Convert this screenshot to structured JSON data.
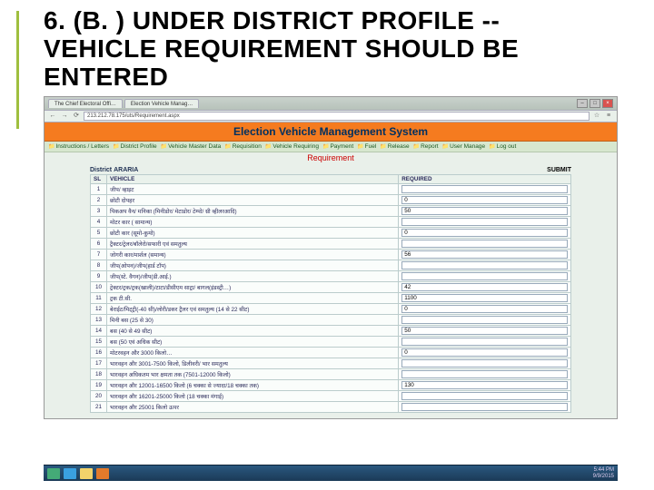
{
  "slide": {
    "heading": "6. (B. ) UNDER DISTRICT PROFILE  -- VEHICLE REQUIREMENT  SHOULD BE ENTERED"
  },
  "browser": {
    "tab1": "The Chief Electoral Offi…",
    "tab2": "Election Vehicle Manag…",
    "url": "213.212.78.175/uts/Requirement.aspx"
  },
  "app": {
    "banner": "Election Vehicle Management System",
    "menu": [
      "Instructions / Letters",
      "District Profile",
      "Vehicle Master Data",
      "Requisition",
      "Vehicle Requiring",
      "Payment",
      "Fuel",
      "Release",
      "Report",
      "User Manage",
      "Log out"
    ],
    "subtitle": "Requirement",
    "district_label": "District",
    "district_value": "ARARIA",
    "submit": "SUBMIT",
    "th_sl": "SL",
    "th_vehicle": "VEHICLE",
    "th_req": "REQUIRED",
    "rows": [
      {
        "n": "1",
        "v": "जीप/ व्हाइट",
        "r": ""
      },
      {
        "n": "2",
        "v": "छोटी दोपहर",
        "r": "0"
      },
      {
        "n": "3",
        "v": "पिकअप वैन/ मनिका (मिनीडोर/ मेटाडोर/ टेम्पो/ थ्री व्हीलरआदि)",
        "r": "50"
      },
      {
        "n": "4",
        "v": "मोटर कार ( सामान्य)",
        "r": ""
      },
      {
        "n": "5",
        "v": "छोटी कार (सूमो-कुमो)",
        "r": "0"
      },
      {
        "n": "6",
        "v": "ट्रैक्टर/ट्रेलर/बॉलेरो/सफारी एवं समतुल्य",
        "r": ""
      },
      {
        "n": "7",
        "v": "जोगरी कार/मार्शल (समान्य)",
        "r": "56"
      },
      {
        "n": "8",
        "v": "जीप(ओपन)/जीप(हार्ड टॉप)",
        "r": ""
      },
      {
        "n": "9",
        "v": "जीप(स्टे. वैगन)/जीप(डी.आई.)",
        "r": ""
      },
      {
        "n": "10",
        "v": "ट्रेक्टर/ट्रक/ट्रक(खाली)/टाटा/डीसीएम साट्रा/ बागल(इंडस्ट्री…)",
        "r": "42"
      },
      {
        "n": "11",
        "v": "ट्रक टी.सी.",
        "r": "1100"
      },
      {
        "n": "12",
        "v": "बेराईट/मिट्ट्री(-40 सी)/लोरी/डकर ट्रैलर एवं समतुल्य (14 से 22 सीट)",
        "r": "0"
      },
      {
        "n": "13",
        "v": "मिनी बस (25 से 30)",
        "r": ""
      },
      {
        "n": "14",
        "v": "बस (40 से 49 सीट)",
        "r": "50"
      },
      {
        "n": "15",
        "v": "बस (50 एवं अधिक सीट)",
        "r": ""
      },
      {
        "n": "16",
        "v": "मोटरवहन और 3000 किलो…",
        "r": "0"
      },
      {
        "n": "17",
        "v": "भारवहन और 3001-7500 किलो, डिलीवरी/ भार समतुल्य",
        "r": ""
      },
      {
        "n": "18",
        "v": "भारवहन अधिकतम भार क्षमता तक (7501-12000 किलो)",
        "r": ""
      },
      {
        "n": "19",
        "v": "भारवहन और 12001-16500 किलो (6 चक्का से ज्यादा/18 चक्का तक)",
        "r": "130"
      },
      {
        "n": "20",
        "v": "भारवहन और 16201-25000 किलो (18 चक्का मंगाई)",
        "r": ""
      },
      {
        "n": "21",
        "v": "भारवहन और 25001 किलो ऊपर",
        "r": ""
      }
    ]
  },
  "tray": {
    "time": "5:44 PM",
    "date": "9/9/2015"
  }
}
